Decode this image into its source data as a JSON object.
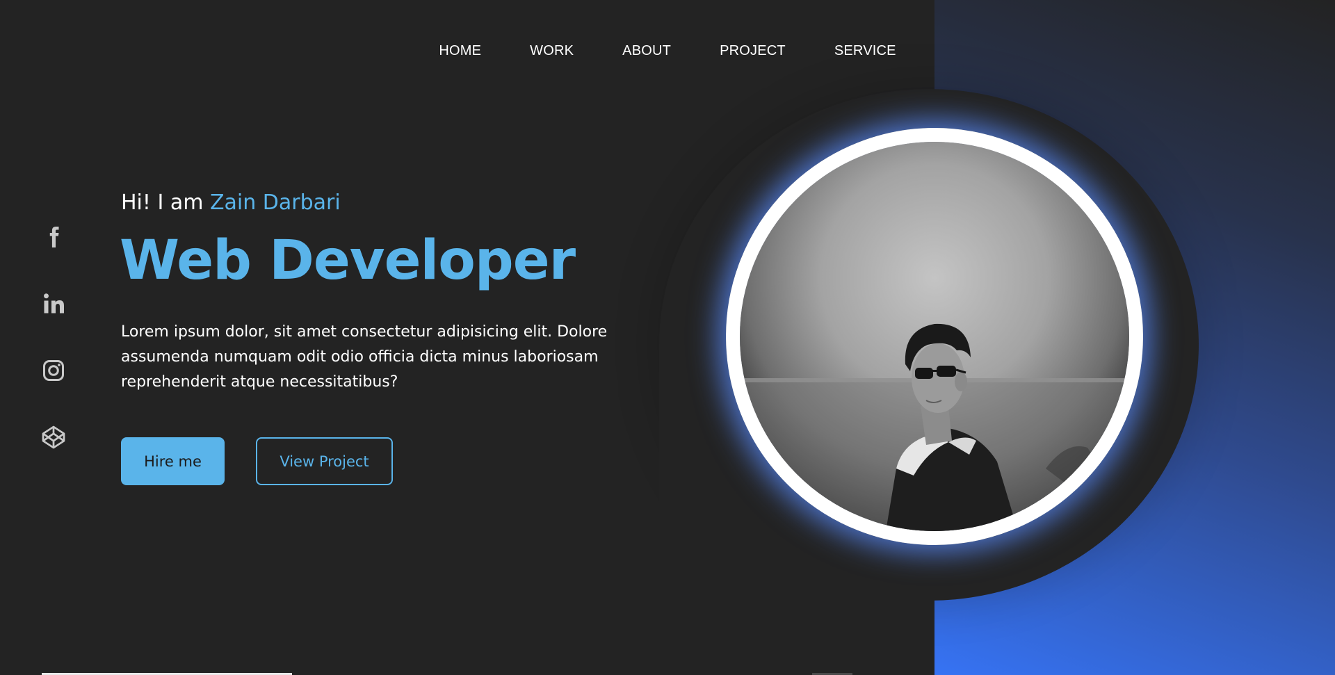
{
  "nav": {
    "items": [
      {
        "label": "HOME"
      },
      {
        "label": "WORK"
      },
      {
        "label": "ABOUT"
      },
      {
        "label": "PROJECT"
      },
      {
        "label": "SERVICE"
      }
    ]
  },
  "social": {
    "items": [
      {
        "icon": "facebook-icon"
      },
      {
        "icon": "linkedin-icon"
      },
      {
        "icon": "instagram-icon"
      },
      {
        "icon": "codepen-icon"
      }
    ]
  },
  "hero": {
    "greeting_prefix": "Hi! I am ",
    "name": "Zain Darbari",
    "title": "Web Developer",
    "description": "Lorem ipsum dolor, sit amet consectetur adipisicing elit. Dolore assumenda numquam odit odio officia dicta minus laboriosam reprehenderit atque necessitatibus?",
    "primary_button": "Hire me",
    "secondary_button": "View Project"
  },
  "colors": {
    "accent": "#5ab4ea",
    "background": "#232323",
    "gradient_end": "#3673f4"
  }
}
